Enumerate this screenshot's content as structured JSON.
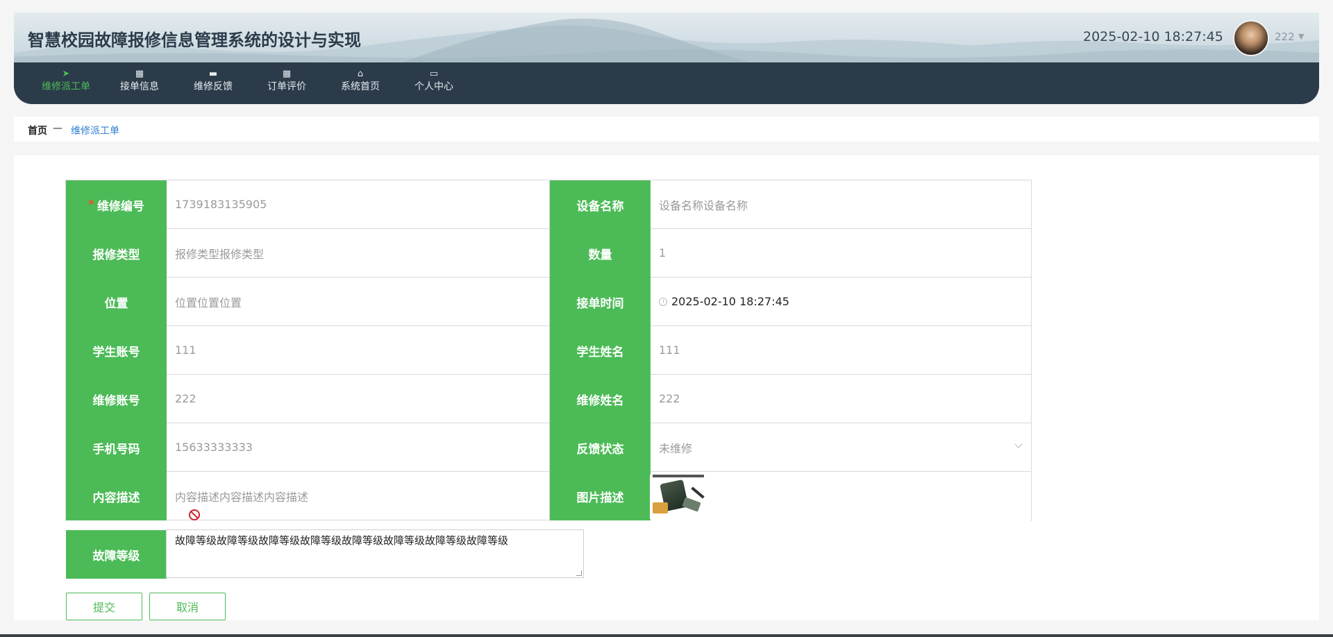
{
  "header": {
    "title": "智慧校园故障报修信息管理系统的设计与实现",
    "datetime": "2025-02-10 18:27:45",
    "user_name": "222"
  },
  "nav": {
    "items": [
      {
        "label": "维修派工单",
        "icon": "send-icon",
        "active": true
      },
      {
        "label": "接单信息",
        "icon": "grid-icon"
      },
      {
        "label": "维修反馈",
        "icon": "printer-icon"
      },
      {
        "label": "订单评价",
        "icon": "grid-icon"
      },
      {
        "label": "系统首页",
        "icon": "home-icon"
      },
      {
        "label": "个人中心",
        "icon": "card-icon"
      }
    ]
  },
  "breadcrumb": {
    "home": "首页",
    "separator": "—",
    "current": "维修派工单"
  },
  "form": {
    "repair_no": {
      "label": "维修编号",
      "required_mark": "*",
      "value": "1739183135905"
    },
    "device_name": {
      "label": "设备名称",
      "placeholder": "设备名称设备名称"
    },
    "repair_type": {
      "label": "报修类型",
      "placeholder": "报修类型报修类型"
    },
    "quantity": {
      "label": "数量",
      "value": "1"
    },
    "location": {
      "label": "位置",
      "placeholder": "位置位置位置"
    },
    "accept_time": {
      "label": "接单时间",
      "value": "2025-02-10 18:27:45"
    },
    "student_account": {
      "label": "学生账号",
      "value": "111"
    },
    "student_name": {
      "label": "学生姓名",
      "value": "111"
    },
    "repair_account": {
      "label": "维修账号",
      "value": "222"
    },
    "repair_name": {
      "label": "维修姓名",
      "value": "222"
    },
    "phone": {
      "label": "手机号码",
      "value": "15633333333"
    },
    "feedback_status": {
      "label": "反馈状态",
      "value": "未维修"
    },
    "content_desc": {
      "label": "内容描述",
      "placeholder": "内容描述内容描述内容描述"
    },
    "image_desc": {
      "label": "图片描述"
    },
    "fault_level": {
      "label": "故障等级",
      "value": "故障等级故障等级故障等级故障等级故障等级故障等级故障等级故障等级"
    }
  },
  "actions": {
    "submit": "提交",
    "cancel": "取消"
  },
  "colors": {
    "accent": "#4cbb57",
    "nav_bg": "#2b3b4a",
    "breadcrumb_link": "#2e7fd0"
  }
}
